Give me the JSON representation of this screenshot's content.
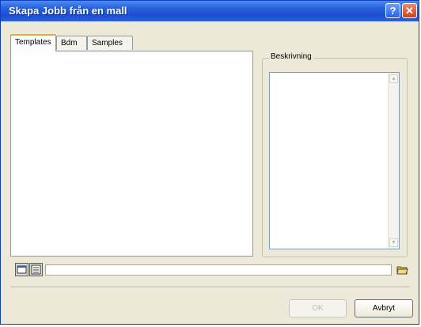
{
  "window": {
    "title": "Skapa Jobb från en mall",
    "help_button": "?",
    "close_button": "✕"
  },
  "tabs": [
    {
      "label": "Templates",
      "active": true
    },
    {
      "label": "Bdm",
      "active": false
    },
    {
      "label": "Samples",
      "active": false
    }
  ],
  "description": {
    "legend": "Beskrivning",
    "text": ""
  },
  "bottom_bar": {
    "path_value": "",
    "icons": [
      "large-icons-view-icon",
      "details-view-icon",
      "folder-icon"
    ]
  },
  "buttons": {
    "ok": "OK",
    "cancel": "Avbryt"
  },
  "colors": {
    "titlebar": "#2862dd",
    "dialog_bg": "#ece9d8",
    "active_tab_accent": "#e8a73f"
  }
}
